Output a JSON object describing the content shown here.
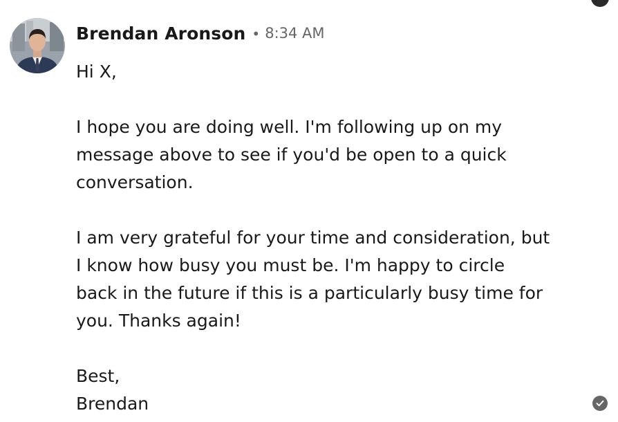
{
  "message": {
    "sender_name": "Brendan Aronson",
    "separator": "•",
    "timestamp": "8:34 AM",
    "avatar_alt": "Brendan Aronson",
    "greeting": "Hi X,",
    "paragraph1": [
      "I hope you are doing well. I'm following up on my",
      "message above to see if you'd be open to a quick",
      "conversation."
    ],
    "paragraph2": [
      "I am very grateful for your time and consideration, but",
      "I know how busy you must be. I'm happy to circle",
      "back in the future if this is a particularly busy time for",
      "you. Thanks again!"
    ],
    "signoff": "Best,",
    "signature": "Brendan"
  },
  "icons": {
    "read_receipt": "check-circle-icon",
    "corner": "more-options-icon"
  },
  "colors": {
    "text": "#191919",
    "muted": "#666666",
    "background": "#ffffff"
  }
}
